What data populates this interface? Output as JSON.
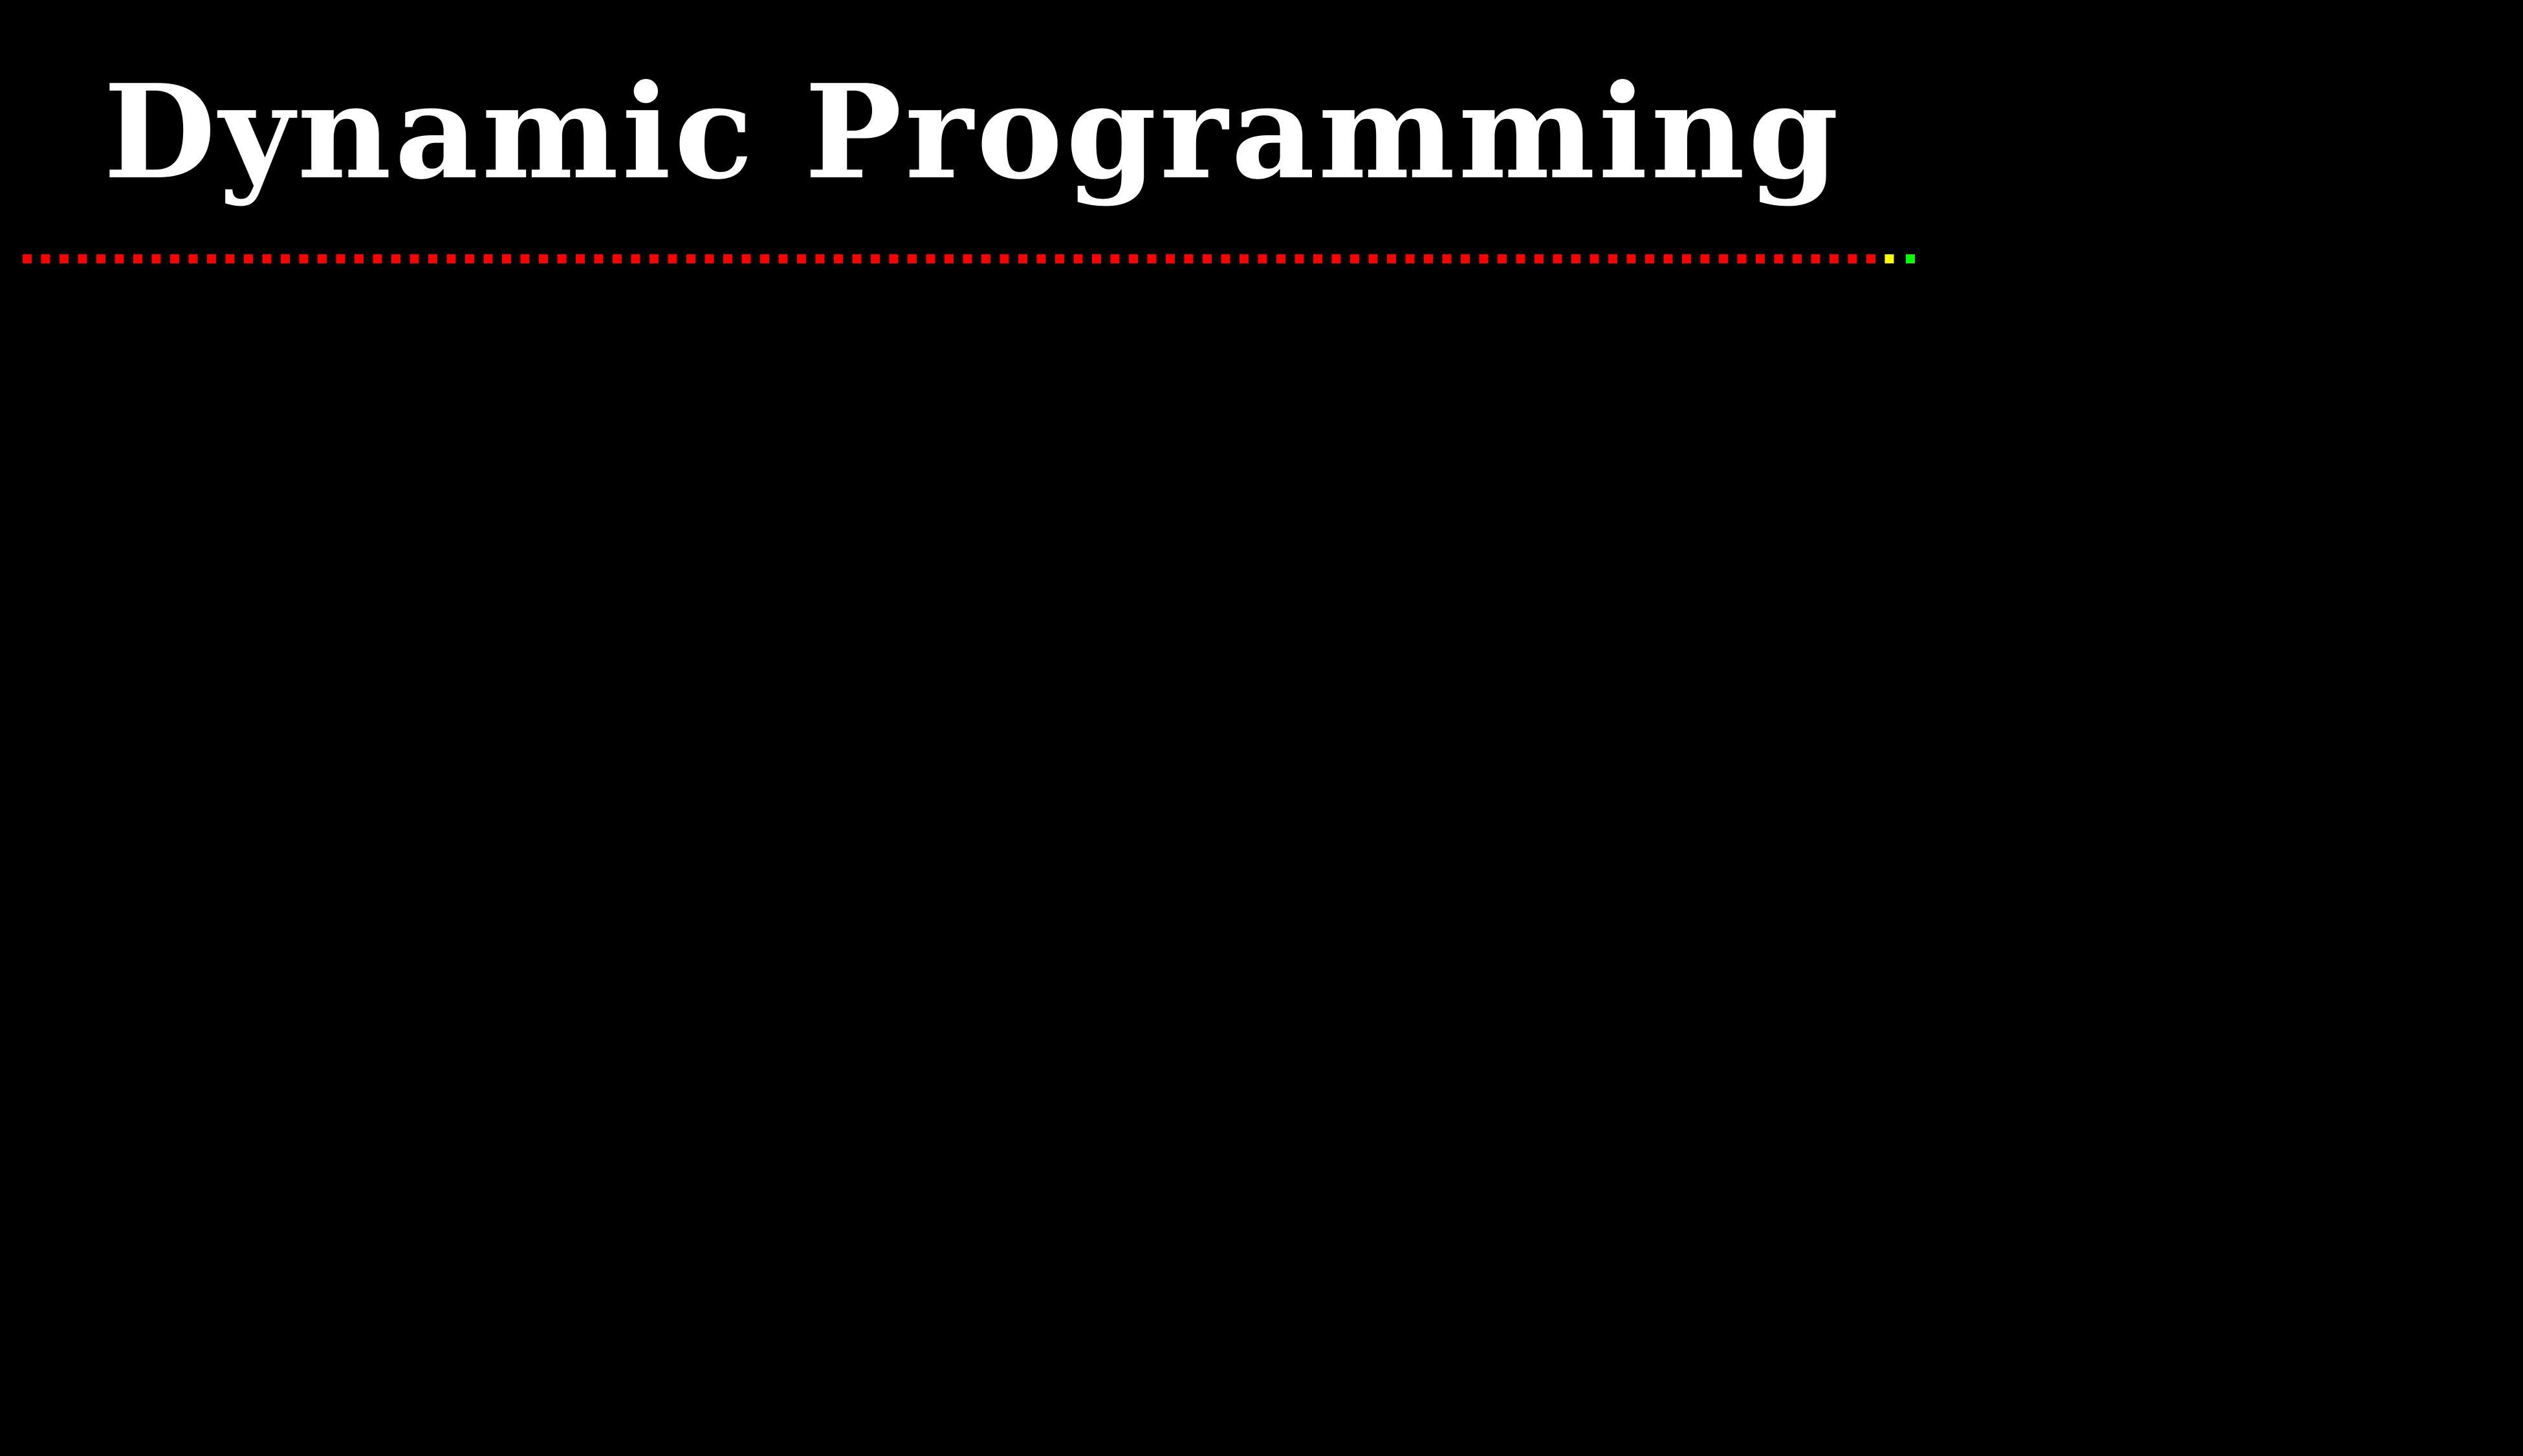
{
  "slide": {
    "title": "Dynamic Programming"
  },
  "progress": {
    "total": 103,
    "completed": 101,
    "current": 102,
    "colors": {
      "completed": "#ff0000",
      "current": "#ffff00",
      "remaining": "#00ff00"
    }
  },
  "colors": {
    "background": "#000000",
    "title": "#ffffff"
  }
}
